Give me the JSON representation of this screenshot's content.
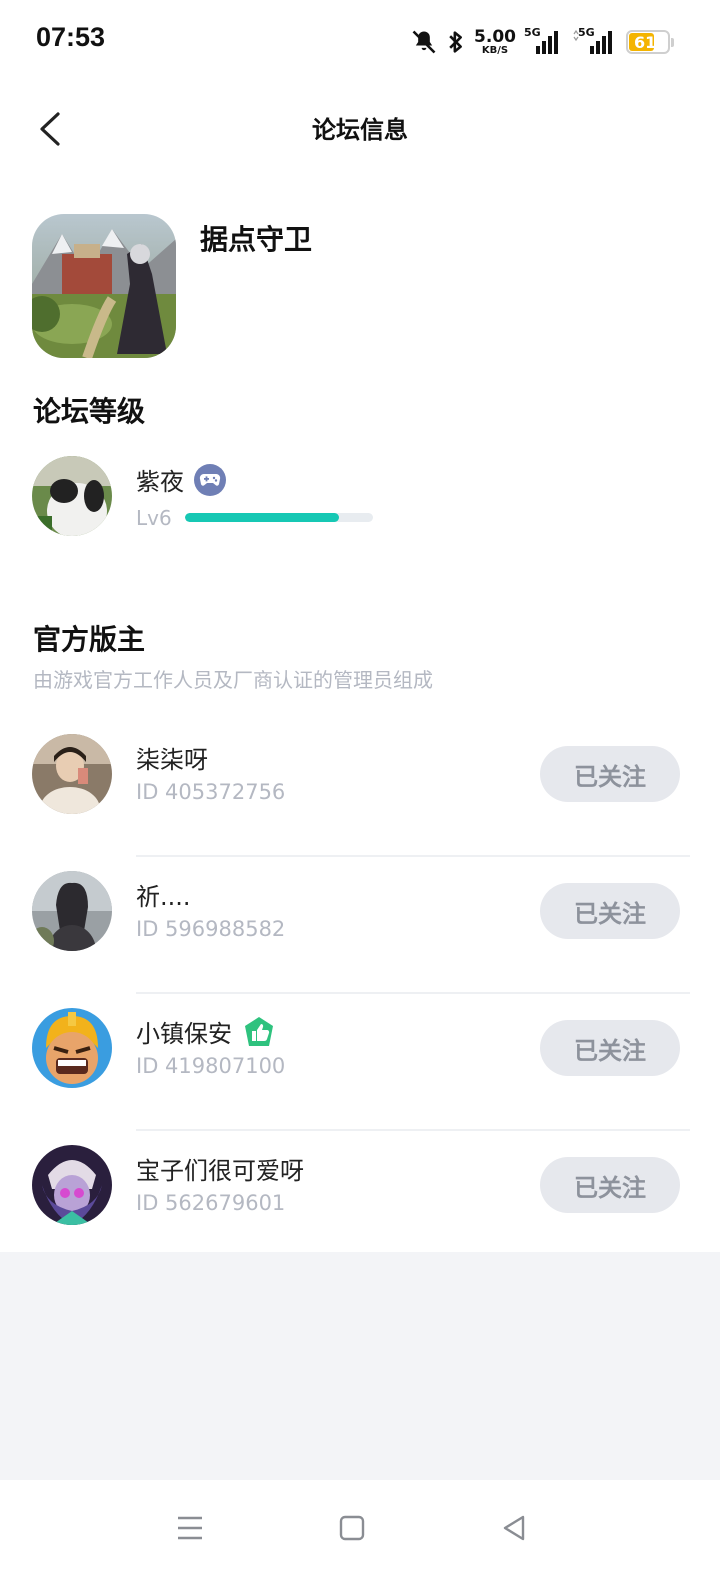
{
  "status_bar": {
    "time": "07:53",
    "net_speed": "5.00",
    "net_unit": "KB/S",
    "signal1_label": "5G",
    "signal2_label": "5G",
    "battery": "61"
  },
  "header": {
    "title": "论坛信息"
  },
  "game": {
    "name": "据点守卫"
  },
  "forum_level": {
    "title": "论坛等级",
    "user_name": "紫夜",
    "level_label": "Lv6",
    "progress": 0.82
  },
  "moderators": {
    "title": "官方版主",
    "subtitle": "由游戏官方工作人员及厂商认证的管理员组成",
    "items": [
      {
        "name": "柒柒呀",
        "id": "ID 405372756",
        "button": "已关注"
      },
      {
        "name": "祈....",
        "id": "ID 596988582",
        "button": "已关注"
      },
      {
        "name": "小镇保安",
        "id": "ID 419807100",
        "button": "已关注"
      },
      {
        "name": "宝子们很可爱呀",
        "id": "ID 562679601",
        "button": "已关注"
      }
    ]
  },
  "colors": {
    "accent": "#16c8b4",
    "battery": "#f4b400",
    "verified": "#2ec27e"
  }
}
